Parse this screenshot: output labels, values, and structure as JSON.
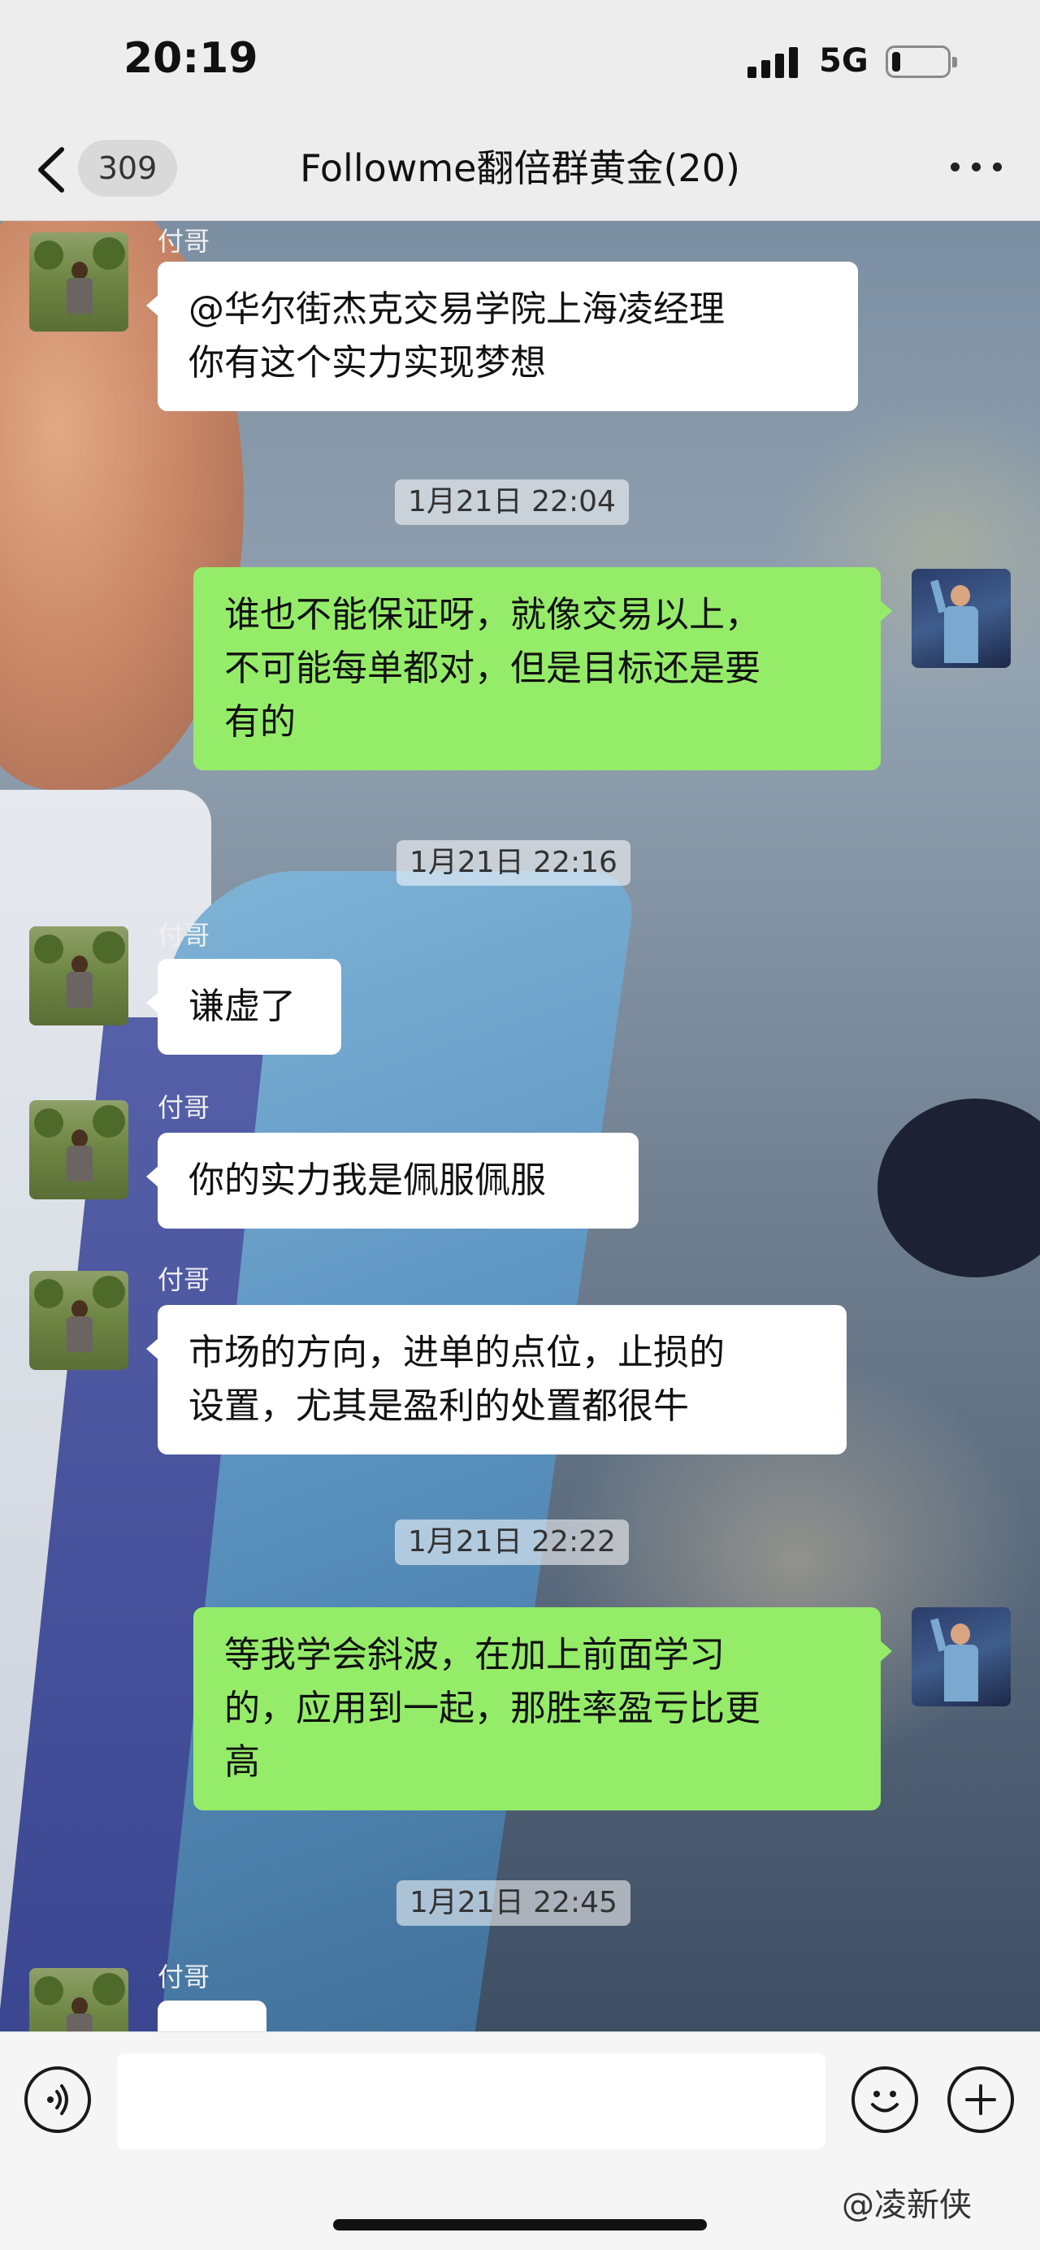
{
  "status_bar": {
    "time": "20:19",
    "network": "5G",
    "battery_level": 0.15
  },
  "nav_bar": {
    "unread_count": "309",
    "title": "Followme翻倍群黄金(20)"
  },
  "chat": {
    "sender_name": "付哥",
    "timestamps": [
      "1月21日 22:04",
      "1月21日 22:16",
      "1月21日 22:22",
      "1月21日 22:45"
    ],
    "messages": [
      {
        "from": "付哥",
        "side": "in",
        "lines": [
          "@华尔街杰克交易学院上海凌经理",
          "你有这个实力实现梦想"
        ]
      },
      {
        "from": "me",
        "side": "out",
        "lines": [
          "谁也不能保证呀，就像交易以上，",
          "不可能每单都对，但是目标还是要",
          "有的"
        ]
      },
      {
        "from": "付哥",
        "side": "in",
        "lines": [
          "谦虚了"
        ]
      },
      {
        "from": "付哥",
        "side": "in",
        "lines": [
          "你的实力我是佩服佩服"
        ]
      },
      {
        "from": "付哥",
        "side": "in",
        "lines": [
          "市场的方向，进单的点位，止损的",
          "设置，尤其是盈利的处置都很牛"
        ]
      },
      {
        "from": "me",
        "side": "out",
        "lines": [
          "等我学会斜波，在加上前面学习",
          "的，应用到一起，那胜率盈亏比更",
          "高"
        ]
      }
    ]
  },
  "input_bar": {
    "watermark": "@凌新侠"
  },
  "colors": {
    "outgoing_bubble": "#95ec69",
    "incoming_bubble": "#ffffff",
    "bar_background": "#ededed"
  },
  "icons": [
    "back-chevron-icon",
    "more-dots-icon",
    "voice-icon",
    "emoji-icon",
    "plus-icon"
  ]
}
